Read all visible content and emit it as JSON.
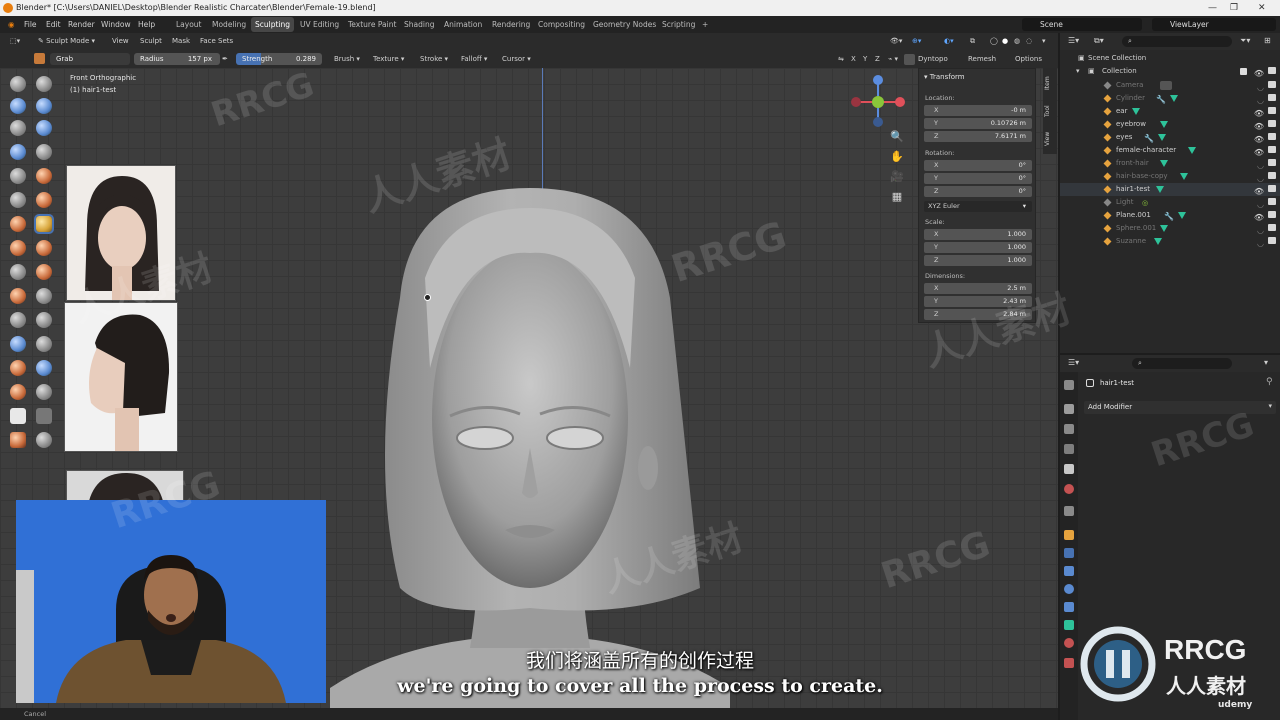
{
  "window": {
    "title": "Blender* [C:\\Users\\DANIEL\\Desktop\\Blender Realistic Charcater\\Blender\\Female-19.blend]"
  },
  "menubar": {
    "items": [
      "File",
      "Edit",
      "Render",
      "Window",
      "Help"
    ],
    "workspace_tabs": [
      "Layout",
      "Modeling",
      "Sculpting",
      "UV Editing",
      "Texture Paint",
      "Shading",
      "Animation",
      "Rendering",
      "Compositing",
      "Geometry Nodes",
      "Scripting",
      "+"
    ],
    "active_tab": "Sculpting",
    "scene": "Scene",
    "view_layer": "ViewLayer"
  },
  "viewport_header": {
    "mode": "Sculpt Mode",
    "menus": [
      "View",
      "Sculpt",
      "Mask",
      "Face Sets"
    ],
    "axes": [
      "X",
      "Y",
      "Z"
    ],
    "dyntopo": "Dyntopo",
    "remesh": "Remesh",
    "options": "Options"
  },
  "tool_settings": {
    "brush": "Grab",
    "radius_label": "Radius",
    "radius_value": "157 px",
    "strength_label": "Strength",
    "strength_value": "0.289",
    "menus": [
      "Brush",
      "Texture",
      "Stroke",
      "Falloff",
      "Cursor"
    ]
  },
  "viewport": {
    "view_name": "Front Orthographic",
    "object_name": "(1) hair1-test"
  },
  "n_panel": {
    "title": "Transform",
    "location_label": "Location:",
    "location": [
      {
        "axis": "X",
        "value": "-0 m"
      },
      {
        "axis": "Y",
        "value": "0.10726 m"
      },
      {
        "axis": "Z",
        "value": "7.6171 m"
      }
    ],
    "rotation_label": "Rotation:",
    "rotation": [
      {
        "axis": "X",
        "value": "0°"
      },
      {
        "axis": "Y",
        "value": "0°"
      },
      {
        "axis": "Z",
        "value": "0°"
      }
    ],
    "rotation_mode": "XYZ Euler",
    "scale_label": "Scale:",
    "scale": [
      {
        "axis": "X",
        "value": "1.000"
      },
      {
        "axis": "Y",
        "value": "1.000"
      },
      {
        "axis": "Z",
        "value": "1.000"
      }
    ],
    "dimensions_label": "Dimensions:",
    "dimensions": [
      {
        "axis": "X",
        "value": "2.5 m"
      },
      {
        "axis": "Y",
        "value": "2.43 m"
      },
      {
        "axis": "Z",
        "value": "2.84 m"
      }
    ],
    "tabs": [
      "Item",
      "Tool",
      "View"
    ]
  },
  "outliner": {
    "root": "Scene Collection",
    "collection": "Collection",
    "objects": [
      {
        "name": "Camera",
        "dim": true
      },
      {
        "name": "Cylinder",
        "dim": true
      },
      {
        "name": "ear",
        "dim": false
      },
      {
        "name": "eyebrow",
        "dim": false
      },
      {
        "name": "eyes",
        "dim": false
      },
      {
        "name": "female-character",
        "dim": false
      },
      {
        "name": "front-hair",
        "dim": true
      },
      {
        "name": "hair-base-copy",
        "dim": true
      },
      {
        "name": "hair1-test",
        "dim": false
      },
      {
        "name": "Light",
        "dim": true
      },
      {
        "name": "Plane.001",
        "dim": false
      },
      {
        "name": "Sphere.001",
        "dim": true
      },
      {
        "name": "Suzanne",
        "dim": true
      }
    ]
  },
  "properties": {
    "object_name": "hair1-test",
    "add_modifier": "Add Modifier"
  },
  "statusbar": {
    "text": "Cancel"
  },
  "subtitles": {
    "cn": "我们将涵盖所有的创作过程",
    "en": "we're going to cover all the process to create."
  },
  "watermarks": {
    "rrcg": "RRCG",
    "cn": "人人素材",
    "brand": "udemy"
  },
  "colors": {
    "accent_blue": "#4772b3",
    "viewport_bg": "#3d3d3d",
    "object_orange": "#e6a33e",
    "modifier_teal": "#2ec39a"
  }
}
